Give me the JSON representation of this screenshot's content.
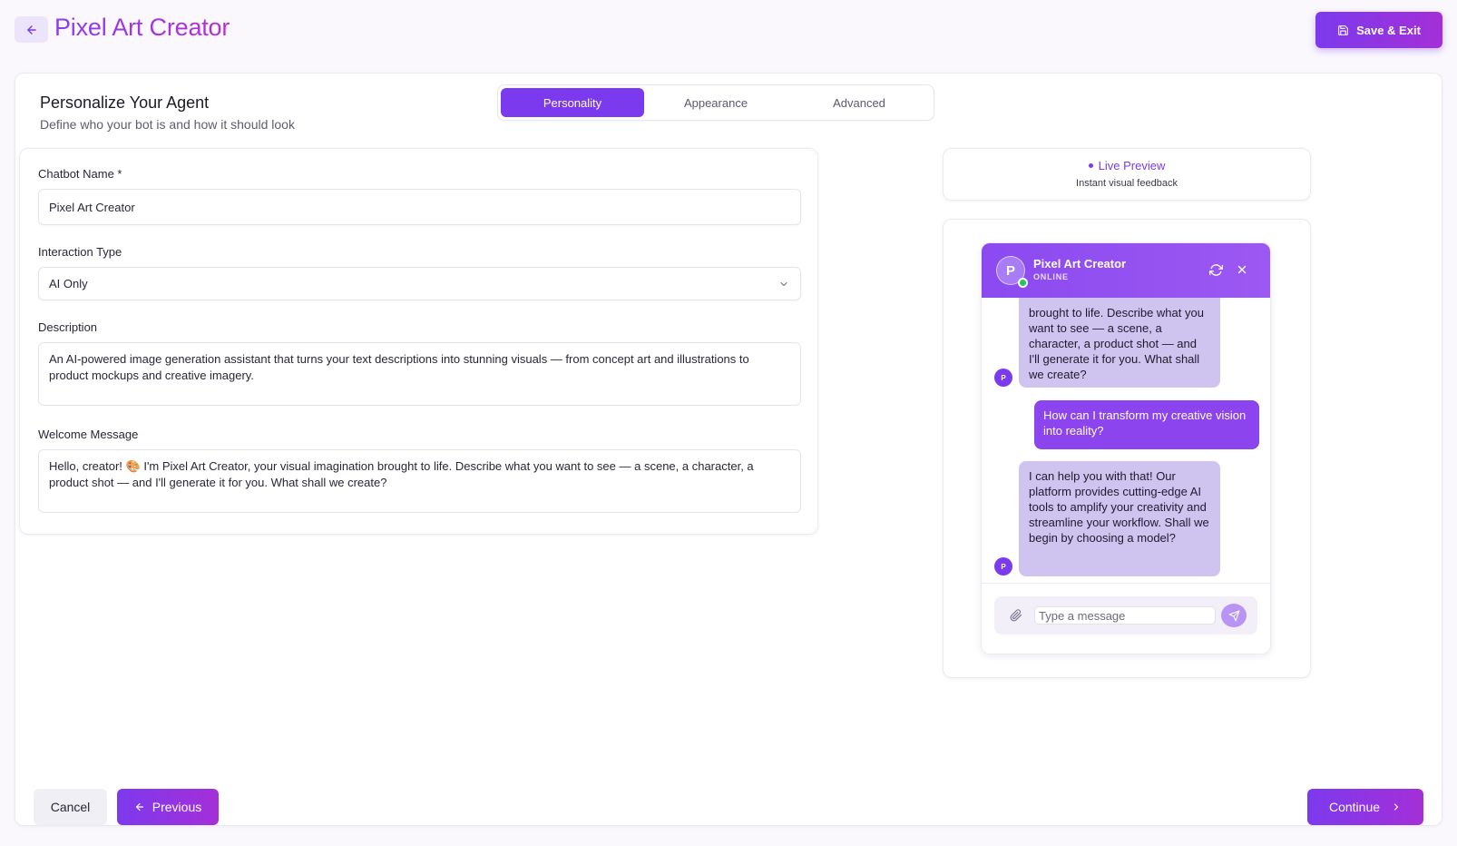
{
  "header": {
    "title": "Pixel Art Creator",
    "save_exit_label": "Save & Exit"
  },
  "section": {
    "title": "Personalize Your Agent",
    "subtitle": "Define who your bot is and how it should look"
  },
  "tabs": [
    {
      "label": "Personality",
      "active": true
    },
    {
      "label": "Appearance",
      "active": false
    },
    {
      "label": "Advanced",
      "active": false
    }
  ],
  "form": {
    "name_label": "Chatbot Name *",
    "name_value": "Pixel Art Creator",
    "interaction_label": "Interaction Type",
    "interaction_value": "AI Only",
    "description_label": "Description",
    "description_value": "An AI-powered image generation assistant that turns your text descriptions into stunning visuals — from concept art and illustrations to product mockups and creative imagery.",
    "welcome_label": "Welcome Message",
    "welcome_value": "Hello, creator! 🎨 I'm Pixel Art Creator, your visual imagination brought to life. Describe what you want to see — a scene, a character, a product shot — and I'll generate it for you. What shall we create?"
  },
  "preview": {
    "live_label": "Live Preview",
    "live_sub": "Instant visual feedback",
    "chat_name": "Pixel Art Creator",
    "chat_status": "ONLINE",
    "avatar_letter": "P",
    "messages": [
      {
        "role": "bot",
        "text": "brought to life. Describe what you want to see — a scene, a character, a product shot — and I'll generate it for you. What shall we create?"
      },
      {
        "role": "user",
        "text": "How can I transform my creative vision into reality?"
      },
      {
        "role": "bot",
        "text": "I can help you with that! Our platform provides cutting-edge AI tools to amplify your creativity and streamline your workflow. Shall we begin by choosing a model?"
      }
    ],
    "input_placeholder": "Type a message"
  },
  "footer": {
    "cancel_label": "Cancel",
    "previous_label": "Previous",
    "continue_label": "Continue"
  },
  "colors": {
    "accent": "#7b3aed",
    "accent_gradient_end": "#a42fd8",
    "bot_bubble": "#cfc3ef",
    "online": "#22c55e"
  }
}
